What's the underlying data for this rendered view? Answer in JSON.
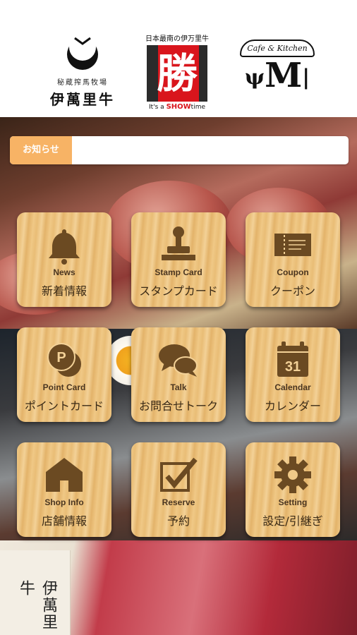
{
  "header": {
    "logo_imari": {
      "sub": "秘蔵搾馬牧場",
      "main": "伊萬里牛"
    },
    "logo_katsu": {
      "top": "日本最南の伊万里牛",
      "char": "勝",
      "bottom_prefix": "It's a ",
      "bottom_show": "SHOW",
      "bottom_suffix": "time"
    },
    "logo_cafe": {
      "arc": "Cafe & Kitchen",
      "letter": "M"
    }
  },
  "notice": {
    "label": "お知らせ",
    "text": ""
  },
  "menu": [
    {
      "en": "News",
      "jp": "新着情報",
      "icon": "bell-icon"
    },
    {
      "en": "Stamp Card",
      "jp": "スタンプカード",
      "icon": "stamp-icon"
    },
    {
      "en": "Coupon",
      "jp": "クーポン",
      "icon": "ticket-icon"
    },
    {
      "en": "Point Card",
      "jp": "ポイントカード",
      "icon": "coin-icon",
      "icon_text": "P"
    },
    {
      "en": "Talk",
      "jp": "お問合せトーク",
      "icon": "chat-bubbles-icon"
    },
    {
      "en": "Calendar",
      "jp": "カレンダー",
      "icon": "calendar-icon",
      "icon_text": "31"
    },
    {
      "en": "Shop Info",
      "jp": "店舗情報",
      "icon": "house-icon"
    },
    {
      "en": "Reserve",
      "jp": "予約",
      "icon": "checkbox-icon"
    },
    {
      "en": "Setting",
      "jp": "設定/引継ぎ",
      "icon": "gear-icon"
    }
  ],
  "footer_photo": {
    "card_text": "伊萬里牛"
  },
  "colors": {
    "notice_accent": "#f7b365",
    "icon": "#6b4a22",
    "wood": "#f0c987"
  }
}
